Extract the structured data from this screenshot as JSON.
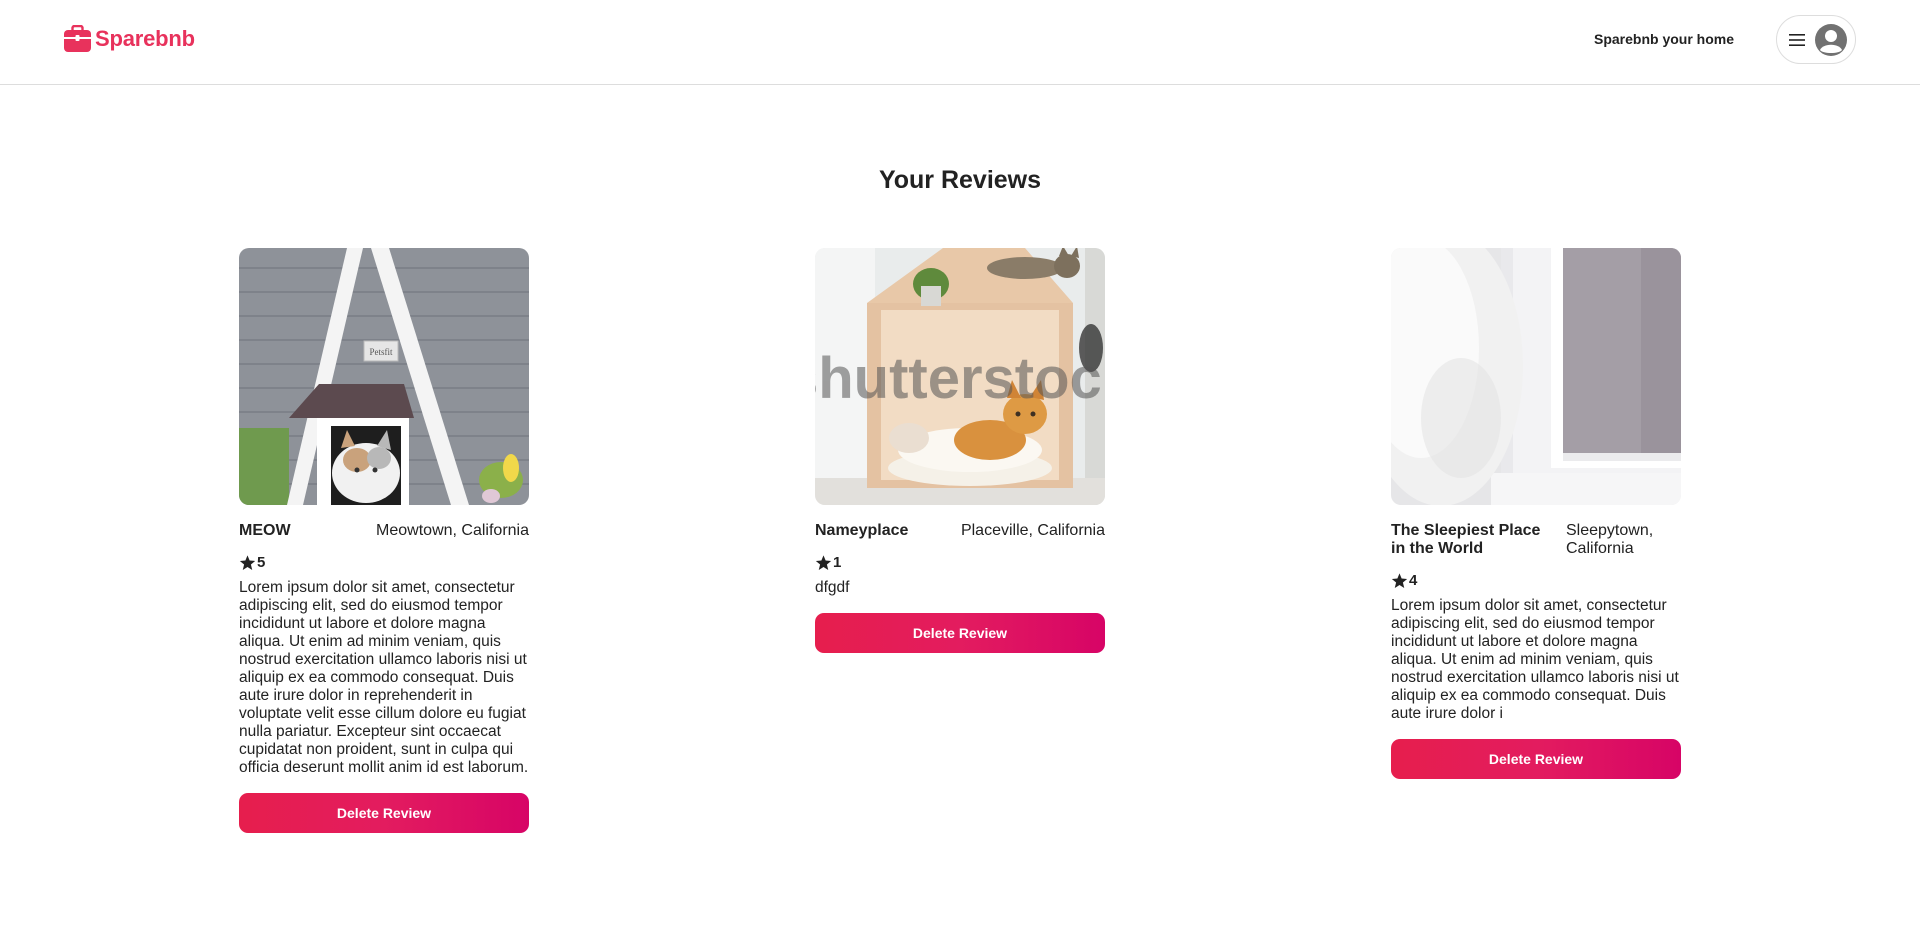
{
  "header": {
    "logo_text": "Sparebnb",
    "host_link": "Sparebnb your home",
    "menu_icon": "menu-icon",
    "avatar_icon": "user-avatar-icon"
  },
  "page": {
    "title": "Your Reviews"
  },
  "colors": {
    "brand": "#e8325c",
    "button_gradient_start": "#e61e4d",
    "button_gradient_end": "#d70466"
  },
  "reviews": [
    {
      "name": "MEOW",
      "location": "Meowtown, California",
      "rating": "5",
      "text": "Lorem ipsum dolor sit amet, consectetur adipiscing elit, sed do eiusmod tempor incididunt ut labore et dolore magna aliqua. Ut enim ad minim veniam, quis nostrud exercitation ullamco laboris nisi ut aliquip ex ea commodo consequat. Duis aute irure dolor in reprehenderit in voluptate velit esse cillum dolore eu fugiat nulla pariatur. Excepteur sint occaecat cupidatat non proident, sunt in culpa qui officia deserunt mollit anim id est laborum.",
      "button": "Delete Review",
      "image_sign": "Petsfit"
    },
    {
      "name": "Nameyplace",
      "location": "Placeville, California",
      "rating": "1",
      "text": "dfgdf",
      "button": "Delete Review",
      "image_watermark": "shutterstock"
    },
    {
      "name": "The Sleepiest Place in the World",
      "location": "Sleepytown, California",
      "rating": "4",
      "text": "Lorem ipsum dolor sit amet, consectetur adipiscing elit, sed do eiusmod tempor incididunt ut labore et dolore magna aliqua. Ut enim ad minim veniam, quis nostrud exercitation ullamco laboris nisi ut aliquip ex ea commodo consequat. Duis aute irure dolor i",
      "button": "Delete Review"
    }
  ]
}
